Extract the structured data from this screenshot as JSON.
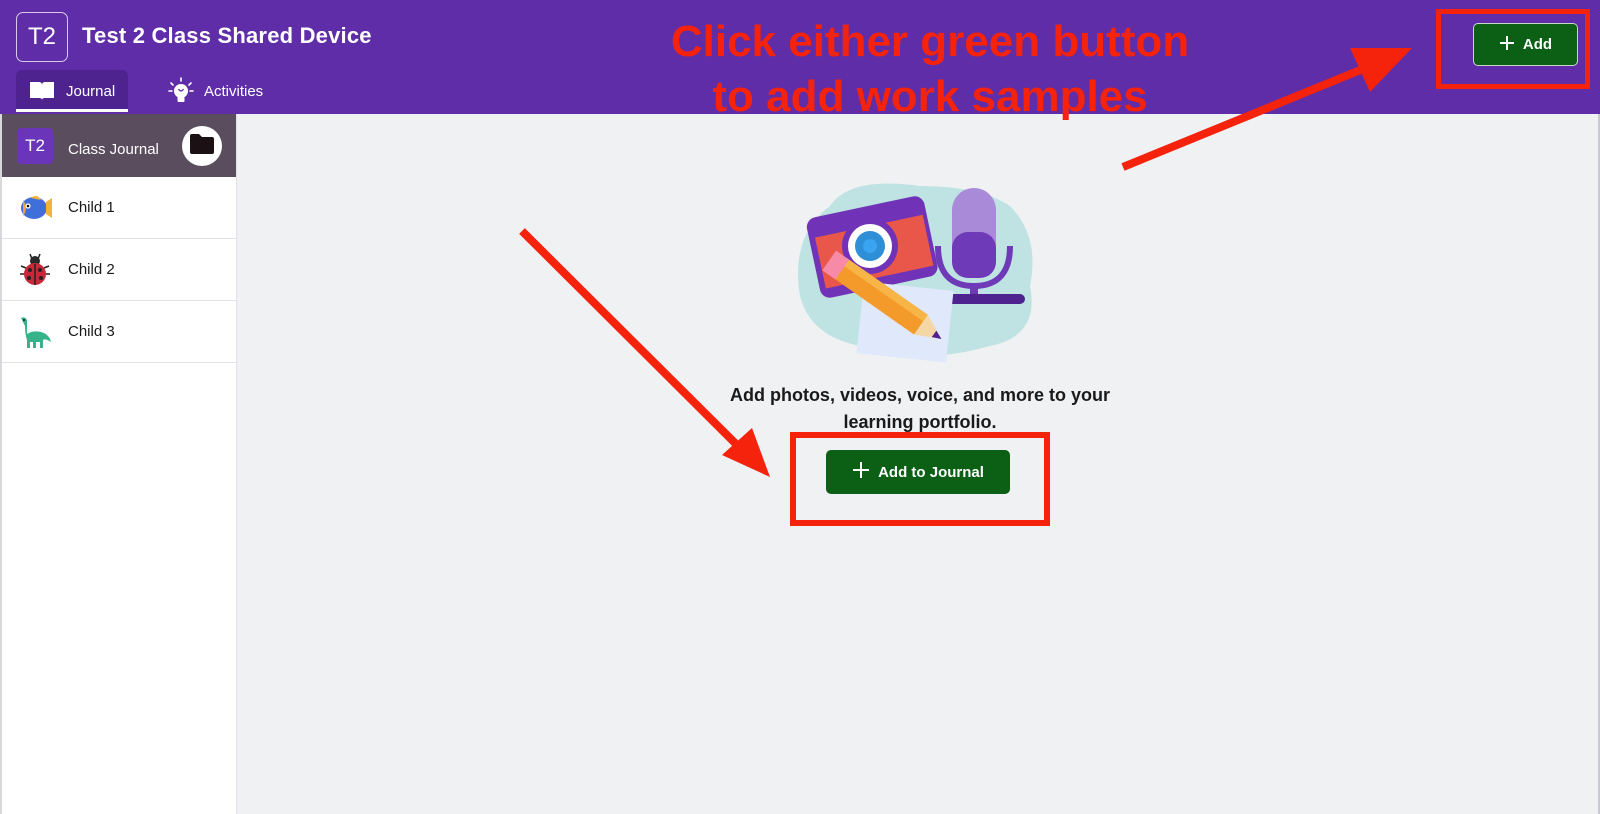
{
  "header": {
    "class_badge": "T2",
    "class_title": "Test 2 Class Shared Device",
    "tabs": [
      {
        "label": "Journal",
        "icon": "book-icon",
        "active": true
      },
      {
        "label": "Activities",
        "icon": "lightbulb-icon",
        "active": false
      }
    ],
    "add_button": {
      "label": "Add",
      "icon": "plus-icon"
    }
  },
  "annotation": {
    "line1": "Click either green button",
    "line2": "to add work samples",
    "color": "#f5220c"
  },
  "sidebar": {
    "class_journal": {
      "badge": "T2",
      "label": "Class Journal",
      "icon": "folder-icon"
    },
    "children": [
      {
        "label": "Child 1",
        "avatar": "fish-icon"
      },
      {
        "label": "Child 2",
        "avatar": "ladybug-icon"
      },
      {
        "label": "Child 3",
        "avatar": "dinosaur-icon"
      }
    ]
  },
  "main": {
    "empty_message": "Add photos, videos, voice, and more to your learning portfolio.",
    "add_to_journal_button": {
      "label": "Add to Journal",
      "icon": "plus-icon"
    }
  },
  "colors": {
    "header_bg": "#5f2da8",
    "accent_green": "#0b6016",
    "annotation_red": "#f5220c"
  }
}
